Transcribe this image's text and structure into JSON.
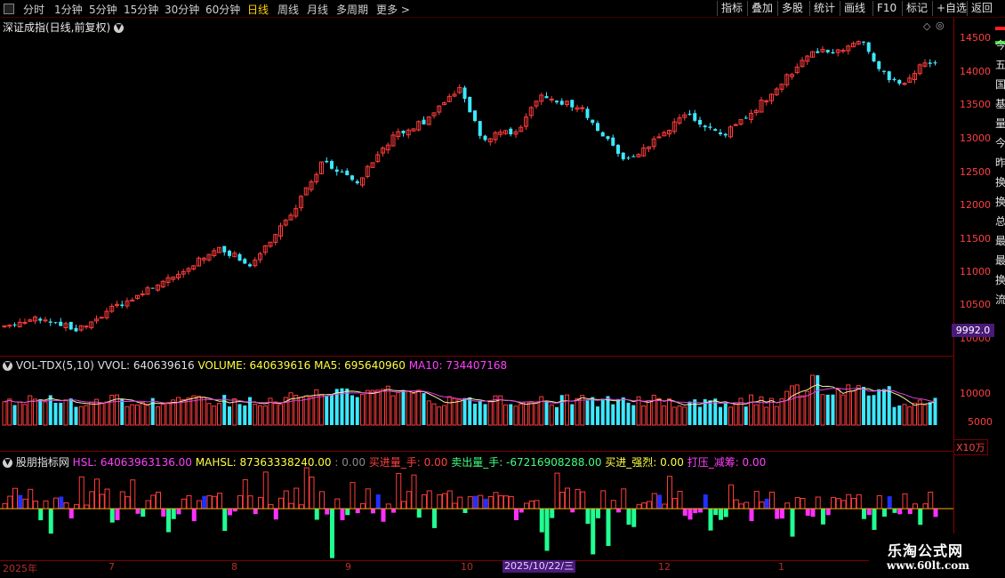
{
  "toolbar": {
    "periods": [
      "分时",
      "1分钟",
      "5分钟",
      "15分钟",
      "30分钟",
      "60分钟",
      "日线",
      "周线",
      "月线",
      "多周期",
      "更多"
    ],
    "active_period": "日线",
    "buttons": [
      "指标",
      "叠加",
      "多股",
      "统计",
      "画线",
      "F10",
      "标记",
      "+自选",
      "返回"
    ]
  },
  "main_title": "深证成指(日线,前复权)",
  "price_axis": [
    "14500",
    "14000",
    "13500",
    "13000",
    "12500",
    "12000",
    "11500",
    "11000",
    "10500",
    "10000"
  ],
  "price_marker": "9992.0",
  "right_panel_chars": [
    "今",
    "五",
    "国",
    "基",
    "量",
    "今",
    "昨",
    "换",
    "换",
    "总",
    "最",
    "最",
    "换",
    "流"
  ],
  "vol": {
    "name": "VOL-TDX(5,10)",
    "vvol_label": "VVOL: 640639616",
    "volume_label": "VOLUME: 640639616",
    "ma5_label": "MA5: 695640960",
    "ma10_label": "MA10: 734407168",
    "axis": [
      "10000",
      "5000"
    ],
    "unit": "X10万"
  },
  "ind": {
    "name": "股朋指标网",
    "hsl": "HSL: 64063963136.00",
    "mahsl": "MAHSL: 87363338240.00",
    "zero": ": 0.00",
    "buy": "买进量_手: 0.00",
    "sell": "卖出量_手: -67216908288.00",
    "strong": "买进_强烈: 0.00",
    "press": "打压_减筹: 0.00"
  },
  "xaxis": [
    "2025年",
    "7",
    "8",
    "9",
    "10",
    "12",
    "1"
  ],
  "cursor_date": "2025/10/22/三",
  "watermark": {
    "line1": "乐淘公式网",
    "line2": "www.60lt.com"
  },
  "colors": {
    "up": "#ff3c3c",
    "down": "#3ce8ff",
    "bg": "#000000",
    "ma5": "#f0f0a0",
    "ma10": "#e040e0",
    "pos": "#ff3c3c",
    "neg_mag": "#ff30ff",
    "neg_grn": "#20ff90",
    "blue": "#2030ff"
  }
}
